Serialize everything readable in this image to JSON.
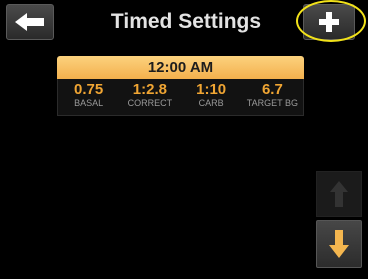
{
  "header": {
    "title": "Timed Settings",
    "back_icon": "arrow-left-icon",
    "add_icon": "plus-icon"
  },
  "segment": {
    "time": "12:00 AM",
    "values": [
      {
        "value": "0.75",
        "label": "BASAL"
      },
      {
        "value": "1:2.8",
        "label": "CORRECT"
      },
      {
        "value": "1:10",
        "label": "CARB"
      },
      {
        "value": "6.7",
        "label": "TARGET BG"
      }
    ]
  },
  "scroll": {
    "up_icon": "arrow-up-icon",
    "down_icon": "arrow-down-icon",
    "up_enabled": false,
    "down_enabled": true
  },
  "colors": {
    "accent_orange": "#f0a533",
    "header_band": "#f3b04d",
    "down_arrow": "#f4b64f",
    "highlight_ring": "#f2e21a"
  }
}
